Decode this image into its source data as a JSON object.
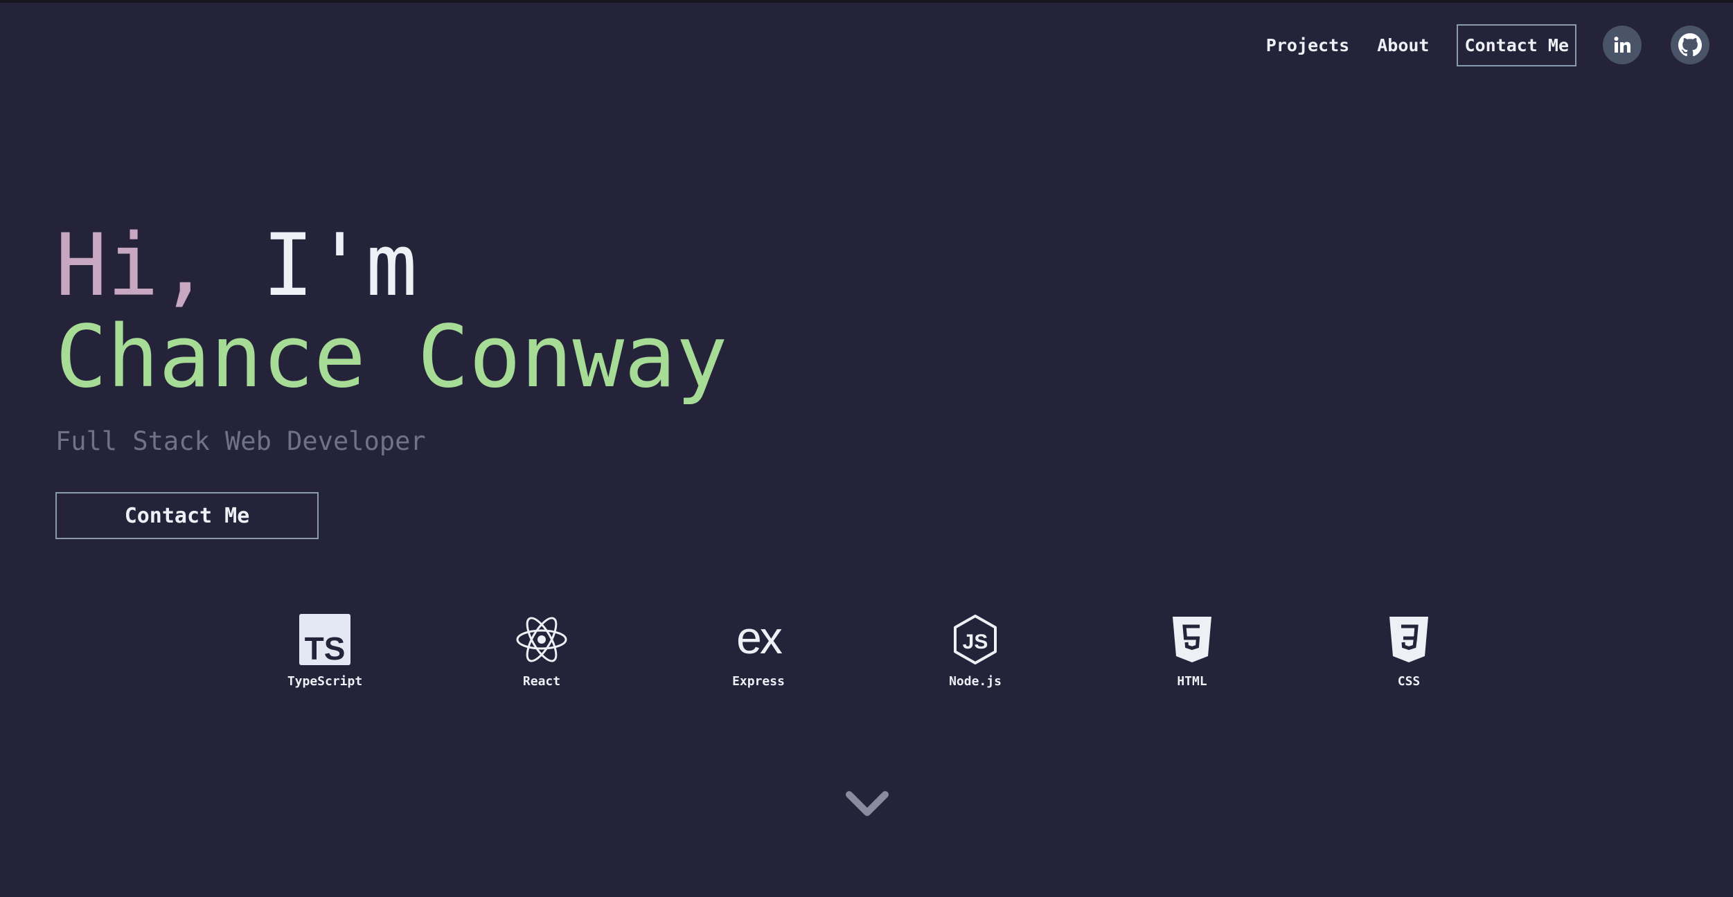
{
  "nav": {
    "projects": "Projects",
    "about": "About",
    "contact": "Contact Me",
    "linkedin_icon": "linkedin-icon",
    "github_icon": "github-icon"
  },
  "hero": {
    "greeting_hi": "Hi,",
    "greeting_im": "I'm",
    "name": "Chance Conway",
    "subtitle": "Full Stack Web Developer",
    "cta": "Contact Me"
  },
  "tech": [
    {
      "label": "TypeScript",
      "icon": "typescript-icon"
    },
    {
      "label": "React",
      "icon": "react-icon"
    },
    {
      "label": "Express",
      "icon": "express-icon"
    },
    {
      "label": "Node.js",
      "icon": "nodejs-icon"
    },
    {
      "label": "HTML",
      "icon": "html5-icon"
    },
    {
      "label": "CSS",
      "icon": "css3-icon"
    }
  ],
  "colors": {
    "background": "#25233a",
    "accent_green": "#a6dc95",
    "accent_pink": "#c7a7c1",
    "text": "#eef0f6",
    "muted": "#6f7388"
  }
}
